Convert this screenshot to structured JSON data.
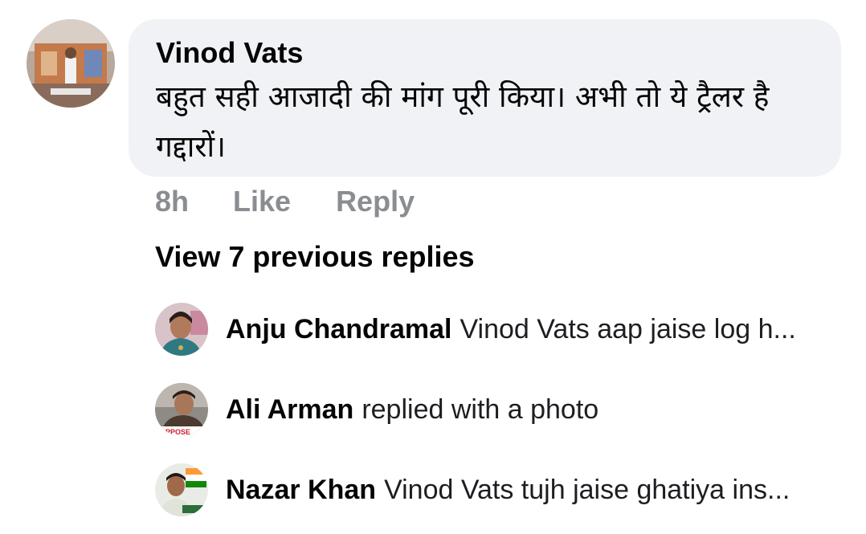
{
  "comment": {
    "author": "Vinod Vats",
    "text": "बहुत सही आजादी की मांग पूरी किया। अभी तो ये ट्रैलर है गद्दारों।",
    "time": "8h",
    "like_label": "Like",
    "reply_label": "Reply"
  },
  "view_previous_label": "View 7 previous replies",
  "replies": [
    {
      "name": "Anju Chandramal",
      "text": "Vinod Vats aap jaise log h..."
    },
    {
      "name": "Ali Arman",
      "text": "replied with a photo",
      "avatar_text": "OPPOSE"
    },
    {
      "name": "Nazar Khan",
      "text": "Vinod Vats tujh jaise ghatiya ins..."
    }
  ]
}
